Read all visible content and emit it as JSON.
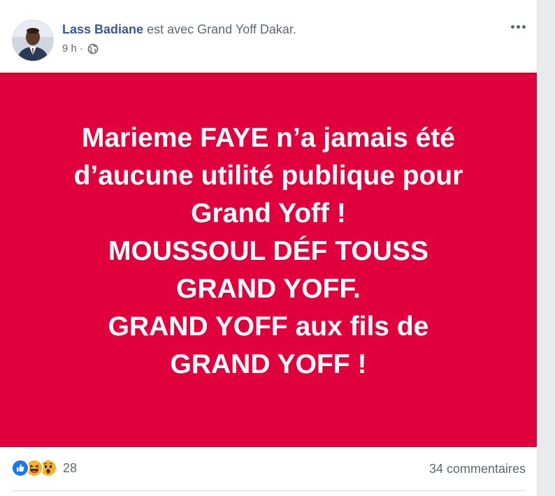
{
  "post": {
    "author": "Lass Badiane",
    "with_text": "est avec",
    "place": "Grand Yoff Dakar.",
    "time": "9 h",
    "separator": "·",
    "privacy_icon": "globe-icon",
    "image_text_lines": [
      "Marieme FAYE n’a jamais été",
      "d’aucune utilité publique pour",
      "Grand Yoff !",
      "MOUSSOUL DÉF TOUSS",
      "GRAND YOFF.",
      "GRAND YOFF aux fils de",
      "GRAND YOFF !"
    ],
    "image_background_color": "#e0003b"
  },
  "footer": {
    "reaction_icons": [
      "like-icon",
      "haha-icon",
      "wow-icon"
    ],
    "reaction_count": "28",
    "comments": "34 commentaires"
  },
  "colors": {
    "link": "#385898",
    "secondary_text": "#606770",
    "like_blue": "#1877f2",
    "emoji_yellow": "#f7b125"
  }
}
